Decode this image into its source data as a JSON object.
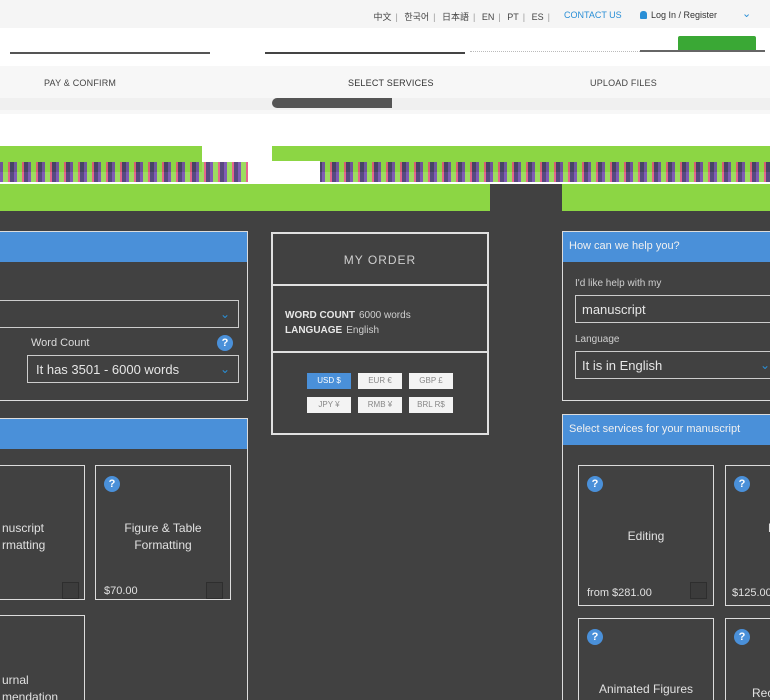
{
  "topbar": {
    "languages": [
      "中文",
      "한국어",
      "日本語",
      "EN",
      "PT",
      "ES"
    ],
    "contact_label": "CONTACT US",
    "login_label": "Log In / Register"
  },
  "steps": [
    "PAY & CONFIRM",
    "SELECT SERVICES",
    "UPLOAD FILES"
  ],
  "left_form": {
    "word_count_label": "Word Count",
    "word_count_value": "It has 3501 - 6000 words"
  },
  "left_services": {
    "cards": [
      {
        "title_line1": "nuscript",
        "title_line2": "rmatting"
      },
      {
        "title_line1": "Figure & Table",
        "title_line2": "Formatting",
        "price": "$70.00"
      },
      {
        "title_line1": "urnal",
        "title_line2": "mendation"
      }
    ]
  },
  "order": {
    "title": "MY ORDER",
    "word_count_label": "WORD COUNT",
    "word_count_value": "6000 words",
    "language_label": "LANGUAGE",
    "language_value": "English",
    "currencies": [
      "USD $",
      "EUR €",
      "GBP £",
      "JPY ¥",
      "RMB ¥",
      "BRL R$"
    ],
    "active_currency": "USD $"
  },
  "help": {
    "title": "How can we help you?",
    "help_label": "I'd like help with my",
    "help_value": "manuscript",
    "language_label": "Language",
    "language_value": "It is in English"
  },
  "right_services": {
    "title": "Select services for your manuscript",
    "cards": [
      {
        "title": "Editing",
        "price": "from $281.00"
      },
      {
        "title_line1": "M",
        "title_line2": "F",
        "price": "$125.00"
      },
      {
        "title": "Animated Figures"
      },
      {
        "title": "Reco"
      }
    ]
  },
  "colors": {
    "accent_blue": "#4a90d9",
    "panel_dark": "#414141",
    "banner_green": "#8cd644",
    "link_blue": "#2a8fd6"
  }
}
